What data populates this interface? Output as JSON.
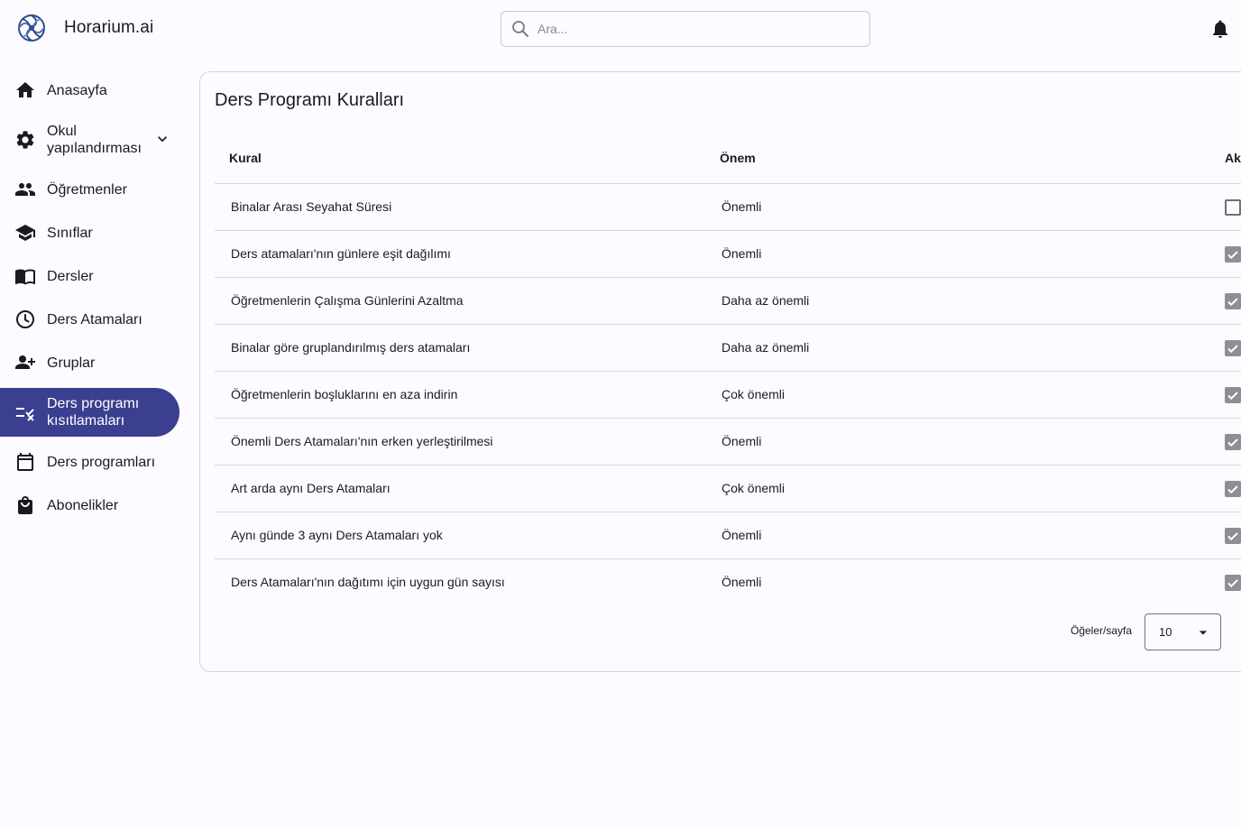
{
  "app": {
    "brand": "Horarium.ai"
  },
  "search": {
    "placeholder": "Ara..."
  },
  "sidebar": {
    "items": [
      {
        "label": "Anasayfa",
        "icon": "home-icon"
      },
      {
        "label": "Okul\nyapılandırması",
        "icon": "gear-icon",
        "expandable": true
      },
      {
        "label": "Öğretmenler",
        "icon": "people-icon"
      },
      {
        "label": "Sınıflar",
        "icon": "graduation-cap-icon"
      },
      {
        "label": "Dersler",
        "icon": "book-icon"
      },
      {
        "label": "Ders Atamaları",
        "icon": "clock-icon"
      },
      {
        "label": "Gruplar",
        "icon": "add-group-icon"
      },
      {
        "label": "Ders programı\nkısıtlamaları",
        "icon": "rule-icon",
        "active": true
      },
      {
        "label": "Ders programları",
        "icon": "calendar-icon"
      },
      {
        "label": "Abonelikler",
        "icon": "shopping-bag-icon"
      }
    ]
  },
  "main": {
    "title": "Ders Programı Kuralları",
    "columns": {
      "rule": "Kural",
      "importance": "Önem",
      "active": "Ak"
    },
    "rows": [
      {
        "rule": "Binalar Arası Seyahat Süresi",
        "importance": "Önemli",
        "active": false
      },
      {
        "rule": "Ders atamaları'nın günlere eşit dağılımı",
        "importance": "Önemli",
        "active": true
      },
      {
        "rule": "Öğretmenlerin Çalışma Günlerini Azaltma",
        "importance": "Daha az önemli",
        "active": true
      },
      {
        "rule": "Binalar göre gruplandırılmış ders atamaları",
        "importance": "Daha az önemli",
        "active": true
      },
      {
        "rule": "Öğretmenlerin boşluklarını en aza indirin",
        "importance": "Çok önemli",
        "active": true
      },
      {
        "rule": "Önemli Ders Atamaları'nın erken yerleştirilmesi",
        "importance": "Önemli",
        "active": true
      },
      {
        "rule": "Art arda aynı Ders Atamaları",
        "importance": "Çok önemli",
        "active": true
      },
      {
        "rule": "Aynı günde 3 aynı Ders Atamaları yok",
        "importance": "Önemli",
        "active": true
      },
      {
        "rule": "Ders Atamaları'nın dağıtımı için uygun gün sayısı",
        "importance": "Önemli",
        "active": true
      }
    ],
    "pagination": {
      "label": "Öğeler/sayfa",
      "value": "10"
    }
  },
  "colors": {
    "accent": "#3a3f8f",
    "checkbox_checked": "#8e8e94"
  }
}
